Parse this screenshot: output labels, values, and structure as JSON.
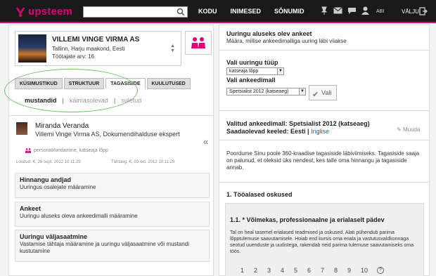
{
  "app": {
    "logo_text": "upsteem",
    "brand_color": "#e0007a"
  },
  "topnav": {
    "search_placeholder": "",
    "items": [
      "KODU",
      "INIMESED",
      "SÕNUMID"
    ],
    "help_label": "ABI",
    "logout_label": "VÄLJU",
    "icons": [
      "pin-icon",
      "envelope-icon",
      "chat-icon",
      "user-icon"
    ]
  },
  "company": {
    "name": "VILLEMI VINGE VIRMA AS",
    "location": "Tallinn, Harju maakond, Eesti",
    "staff": "Töötajate arv: 16"
  },
  "tabs": [
    {
      "label": "KÜSIMUSTIKUD",
      "active": false
    },
    {
      "label": "STRUKTUUR",
      "active": false
    },
    {
      "label": "TAGASISIDE",
      "active": true
    },
    {
      "label": "KUULUTUSED",
      "active": false
    }
  ],
  "filters": {
    "active": "mustandid",
    "inactive": [
      "käimasolevad",
      "suletud"
    ],
    "separator": "|"
  },
  "person": {
    "name": "Miranda Veranda",
    "role": "Villemi Vinge Virma AS, Dokumendihalduse ekspert",
    "tags": "personalihindamine, katseaja lõpp",
    "created": "Loodud: K, 26 sept. 2012 10:11:29",
    "deadline": "Tähtaeg: K, 03 okt. 2012 10:11:29"
  },
  "cards": [
    {
      "title": "Hinnangu andjad",
      "subtitle": "Uuringus osalejate määramine"
    },
    {
      "title": "Ankeet",
      "subtitle": "Uuringu aluseks oleva ankeedimalli määramine"
    },
    {
      "title": "Uuringu väljasaatmine",
      "subtitle": "Vastamise tähtaja määramine ja uuringu väljasaatmine või mustandi kustutamine"
    }
  ],
  "right": {
    "title": "Uuringu aluseks olev ankeet",
    "subtitle": "Määra, millise ankeedimalliga uuring läbi viiakse",
    "type_label": "Vali uuringu tüüp",
    "type_value": "katseaja lõpp",
    "template_label": "Vali ankeedimall",
    "template_value": "Spetsialist 2012 (katseaeg)",
    "choose_button": "Vali",
    "selected_model": "Valitud ankeedimall: Spetsialist 2012 (katseaeg)",
    "languages_label": "Saadaolevad keeled: Eesti |",
    "language_link": "Inglise",
    "edit_label": "Muuda",
    "description": "Poordume Sinu poole 360-kraadise tagasiside läbiviimiseks. Tagasiside saaja on palunud, et oleksid üks nendest, kes talle oma hinnangu ja tagasiside annab.",
    "section_title": "1. Tööalased oskused",
    "question_title": "1.1. * Võimekas, professionaalne ja erialaselt pädev",
    "question_text": "Tal on heal tasemel erialased teadmised ja oskused. Alati pühendub parima lõpptulemuse saavutamisele. Hoiab end kursis oma eriala ja vastutusvaldkonnaga seotud uuenduste ja uudistega, rakendab neid parima tulemuse saavutamiseks oma töös.",
    "scale": [
      "1",
      "2",
      "3",
      "4",
      "5",
      "6",
      "7",
      "8",
      "9",
      "10"
    ],
    "help_symbol": "?"
  }
}
